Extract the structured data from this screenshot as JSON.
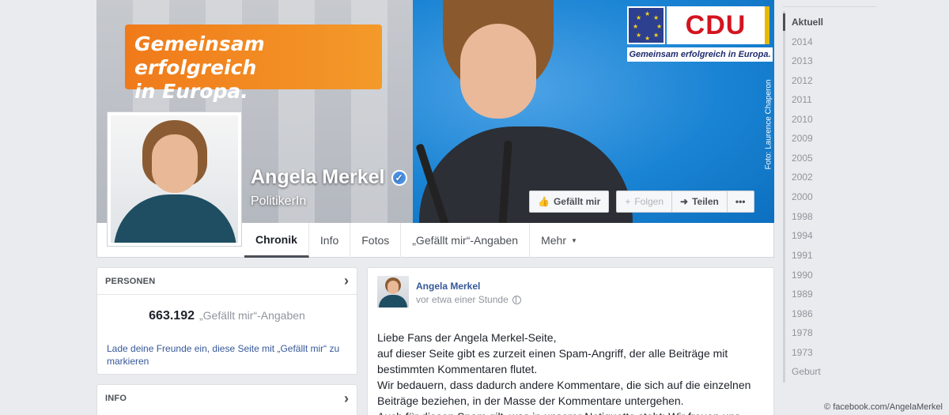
{
  "cover": {
    "slogan_line1": "Gemeinsam erfolgreich",
    "slogan_line2": "in Europa.",
    "logo_brand": "CDU",
    "logo_tagline": "Gemeinsam erfolgreich in Europa.",
    "photo_credit": "Foto: Laurence Chaperon"
  },
  "page": {
    "name": "Angela Merkel",
    "category": "PolitikerIn"
  },
  "actions": {
    "like": "Gefällt mir",
    "follow": "Folgen",
    "share": "Teilen",
    "more": "•••"
  },
  "tabs": [
    {
      "label": "Chronik"
    },
    {
      "label": "Info"
    },
    {
      "label": "Fotos"
    },
    {
      "label": "„Gefällt mir“-Angaben"
    },
    {
      "label": "Mehr"
    }
  ],
  "people_card": {
    "title": "PERSONEN",
    "like_count": "663.192",
    "like_label": "„Gefällt mir“-Angaben",
    "invite_text": "Lade deine Freunde ein, diese Seite mit „Gefällt mir“ zu markieren"
  },
  "info_card": {
    "title": "INFO"
  },
  "post": {
    "author": "Angela Merkel",
    "time": "vor etwa einer Stunde",
    "lines": [
      "Liebe Fans der Angela Merkel-Seite,",
      "auf dieser Seite gibt es zurzeit einen Spam-Angriff, der alle Beiträge mit",
      "bestimmten Kommentaren flutet.",
      "Wir bedauern, dass dadurch andere Kommentare, die sich auf die einzelnen",
      "Beiträge beziehen, in der Masse der Kommentare untergehen.",
      "Auch für diesen Spam gilt, was in unserer Netiquette steht: Wir freuen uns"
    ]
  },
  "timeline": {
    "years": [
      "Aktuell",
      "2014",
      "2013",
      "2012",
      "2011",
      "2010",
      "2009",
      "2005",
      "2002",
      "2000",
      "1998",
      "1994",
      "1991",
      "1990",
      "1989",
      "1986",
      "1978",
      "1973",
      "Geburt"
    ]
  },
  "source": "© facebook.com/AngelaMerkel",
  "colors": {
    "link": "#365899",
    "slogan_orange": "#f07a1a",
    "cdu_red": "#d3141f",
    "verified_blue": "#4a90e2"
  }
}
